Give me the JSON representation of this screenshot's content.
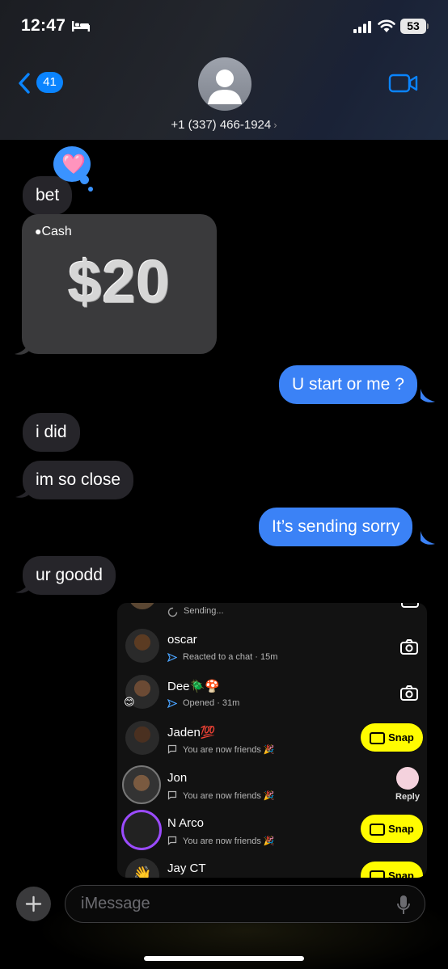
{
  "status_bar": {
    "time": "12:47",
    "battery": "53"
  },
  "header": {
    "back_count": "41",
    "contact": "+1 (337) 466-1924",
    "contact_chevron": "›"
  },
  "tapback": {
    "emoji": "🩷"
  },
  "messages": [
    {
      "dir": "in",
      "text": "bet"
    },
    {
      "dir": "in",
      "type": "apple-cash",
      "brand": "Cash",
      "amount": "$20"
    },
    {
      "dir": "out",
      "text": "U start or me ?"
    },
    {
      "dir": "in",
      "text": "i did"
    },
    {
      "dir": "in",
      "text": "im so close"
    },
    {
      "dir": "out",
      "text": "It’s sending sorry"
    },
    {
      "dir": "in",
      "text": "ur goodd"
    }
  ],
  "snapchat": {
    "top_status": "Sending...",
    "rows": [
      {
        "name": "oscar",
        "status": "Reacted to a chat · 15m",
        "action": "camera"
      },
      {
        "name": "Dee🪲🍄",
        "status": "Opened · 31m",
        "action": "camera",
        "badge": "😊"
      },
      {
        "name": "Jaden💯",
        "status": "You are now friends 🎉",
        "action": "Snap"
      },
      {
        "name": "Jon",
        "status": "You are now friends 🎉",
        "action": "Reply"
      },
      {
        "name": "N Arco",
        "status": "You are now friends 🎉",
        "action": "Snap"
      },
      {
        "name": "Jay CT",
        "status": "",
        "action": "Snap",
        "avatar_emoji": "👋"
      }
    ]
  },
  "composer": {
    "placeholder": "iMessage"
  },
  "colors": {
    "outgoing": "#3b82f6",
    "incoming": "#26252a",
    "accent": "#0a84ff",
    "snap_yellow": "#fffc00"
  }
}
